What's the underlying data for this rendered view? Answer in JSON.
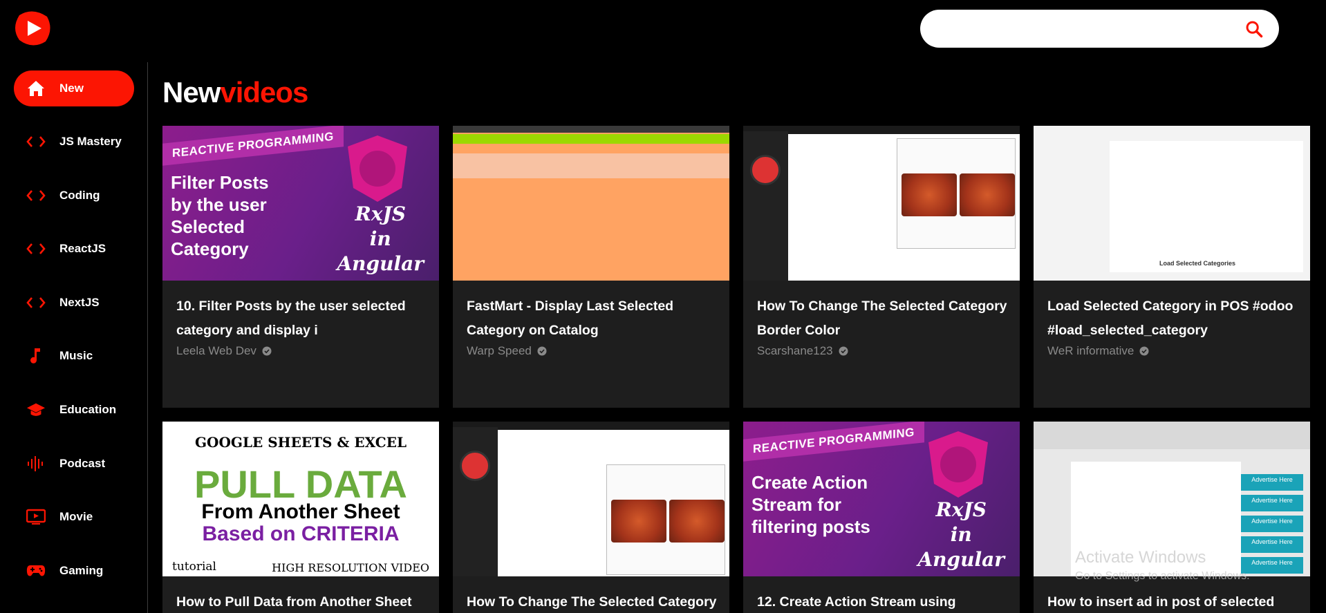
{
  "search": {
    "value": "",
    "placeholder": ""
  },
  "sidebar": {
    "items": [
      {
        "label": "New",
        "icon": "home-icon",
        "active": true
      },
      {
        "label": "JS Mastery",
        "icon": "code-icon"
      },
      {
        "label": "Coding",
        "icon": "code-icon"
      },
      {
        "label": "ReactJS",
        "icon": "code-icon"
      },
      {
        "label": "NextJS",
        "icon": "code-icon"
      },
      {
        "label": "Music",
        "icon": "music-note-icon"
      },
      {
        "label": "Education",
        "icon": "graduation-cap-icon"
      },
      {
        "label": "Podcast",
        "icon": "podcast-icon"
      },
      {
        "label": "Movie",
        "icon": "tv-icon"
      },
      {
        "label": "Gaming",
        "icon": "gamepad-icon"
      }
    ]
  },
  "heading": {
    "part1": "New",
    "part2": "videos"
  },
  "videos": [
    {
      "title": "10. Filter Posts by the user selected category and display i",
      "channel": "Leela Web Dev",
      "thumb": {
        "banner": "REACTIVE PROGRAMMING",
        "text1": "Filter Posts",
        "text2": "by the user",
        "text3": "Selected",
        "text4": "Category",
        "right1": "RxJS",
        "right2": "in",
        "right3": "Angular"
      }
    },
    {
      "title": "FastMart - Display Last Selected Category on Catalog",
      "channel": "Warp Speed"
    },
    {
      "title": "How To Change The Selected Category Border Color",
      "channel": "Scarshane123"
    },
    {
      "title": "Load Selected Category in POS #odoo #load_selected_category",
      "channel": "WeR informative",
      "thumb": {
        "label": "Load Selected Categories"
      }
    },
    {
      "title": "How to Pull Data from Another Sheet",
      "channel": "",
      "thumb": {
        "l1": "GOOGLE SHEETS & EXCEL",
        "l2": "PULL DATA",
        "l3": "From Another Sheet",
        "l4": "Based on CRITERIA",
        "l5": "tutorial",
        "l6": "HIGH RESOLUTION VIDEO"
      }
    },
    {
      "title": "How To Change The Selected Category",
      "channel": ""
    },
    {
      "title": "12. Create Action Stream using",
      "channel": "",
      "thumb": {
        "banner": "REACTIVE PROGRAMMING",
        "text1": "Create Action",
        "text2": "Stream for",
        "text3": "filtering posts",
        "right1": "RxJS",
        "right2": "in",
        "right3": "Angular"
      }
    },
    {
      "title": "How to insert ad in post of selected",
      "channel": "",
      "thumb": {
        "ad": "Advertise Here"
      }
    }
  ],
  "watermark": {
    "line1": "Activate Windows",
    "line2": "Go to Settings to activate Windows."
  }
}
